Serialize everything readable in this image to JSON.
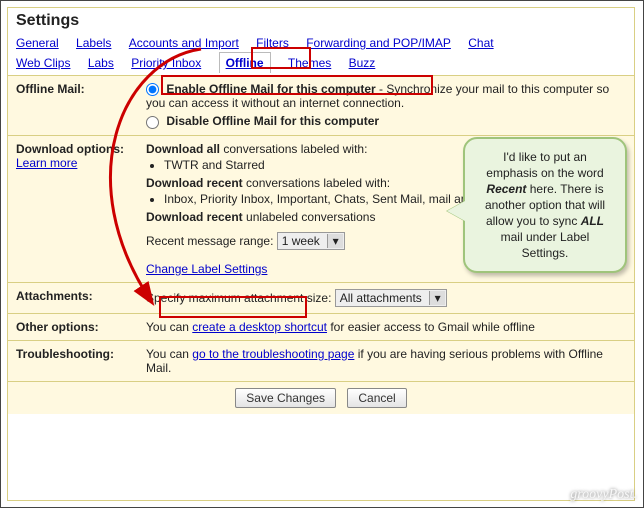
{
  "title": "Settings",
  "tabs": {
    "general": "General",
    "labels": "Labels",
    "accounts": "Accounts and Import",
    "filters": "Filters",
    "forwarding": "Forwarding and POP/IMAP",
    "chat": "Chat",
    "webclips": "Web Clips",
    "labs": "Labs",
    "priority": "Priority Inbox",
    "offline": "Offline",
    "themes": "Themes",
    "buzz": "Buzz"
  },
  "offline_mail": {
    "row_label": "Offline Mail:",
    "enable_label": "Enable Offline Mail for this computer",
    "enable_desc": " - Synchronize your mail to this computer so you can access it without an internet connection.",
    "disable_label": "Disable Offline Mail for this computer"
  },
  "download_options": {
    "row_label": "Download options:",
    "learn_more": "Learn more",
    "download_all_label": "Download all",
    "download_all_rest": " conversations labeled with:",
    "all_items": "TWTR and Starred",
    "download_recent_label": "Download recent",
    "download_recent_rest": " conversations labeled with:",
    "recent_items": "Inbox, Priority Inbox, Important, Chats, Sent Mail, mail and SU.PR",
    "recent_unlabeled_label": "Download recent",
    "recent_unlabeled_rest": " unlabeled conversations",
    "range_label": "Recent message range: ",
    "range_value": "1 week",
    "change_link": "Change Label Settings"
  },
  "attachments": {
    "row_label": "Attachments:",
    "desc": "Specify maximum attachment size:",
    "select_value": "All attachments"
  },
  "other": {
    "row_label": "Other options:",
    "pre": "You can ",
    "link": "create a desktop shortcut",
    "post": " for easier access to Gmail while offline"
  },
  "trouble": {
    "row_label": "Troubleshooting:",
    "pre": "You can ",
    "link": "go to the troubleshooting page",
    "post": " if you are having serious problems with Offline Mail."
  },
  "buttons": {
    "save": "Save Changes",
    "cancel": "Cancel"
  },
  "callout": {
    "line1": "I'd like to put an emphasis on the word ",
    "em": "Recent",
    "line2": " here. There is another option that will allow you to sync ",
    "em2": "ALL",
    "line3": " mail under Label Settings."
  },
  "watermark": "groovyPost."
}
